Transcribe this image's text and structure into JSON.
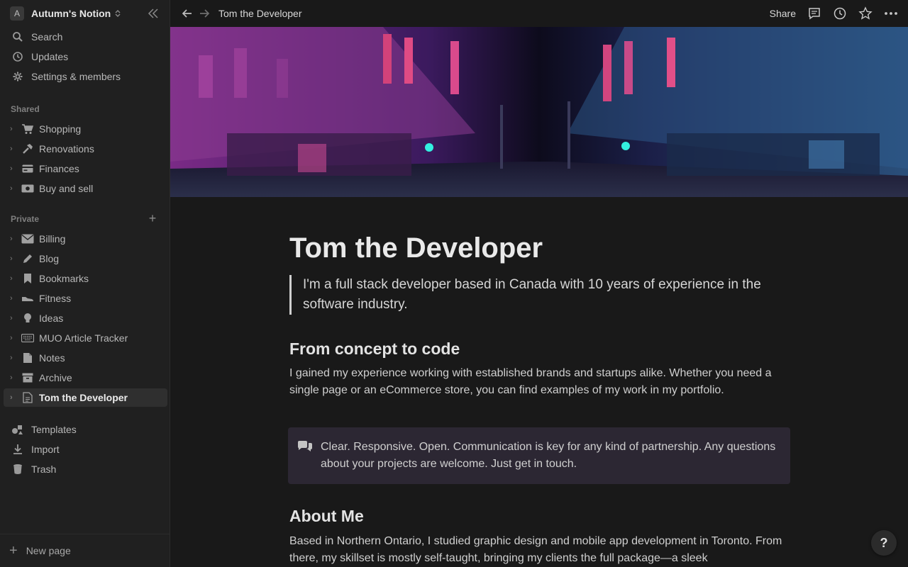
{
  "workspace": {
    "avatar": "A",
    "name": "Autumn's Notion"
  },
  "sidebar": {
    "top": [
      {
        "label": "Search",
        "icon": "search-icon"
      },
      {
        "label": "Updates",
        "icon": "clock-icon"
      },
      {
        "label": "Settings & members",
        "icon": "gear-icon"
      }
    ],
    "shared_label": "Shared",
    "shared": [
      {
        "label": "Shopping",
        "icon": "cart-icon"
      },
      {
        "label": "Renovations",
        "icon": "hammer-icon"
      },
      {
        "label": "Finances",
        "icon": "card-icon"
      },
      {
        "label": "Buy and sell",
        "icon": "money-icon"
      }
    ],
    "private_label": "Private",
    "private": [
      {
        "label": "Billing",
        "icon": "envelope-icon"
      },
      {
        "label": "Blog",
        "icon": "pencil-icon"
      },
      {
        "label": "Bookmarks",
        "icon": "bookmark-icon"
      },
      {
        "label": "Fitness",
        "icon": "shoe-icon"
      },
      {
        "label": "Ideas",
        "icon": "bulb-icon"
      },
      {
        "label": "MUO Article Tracker",
        "icon": "keyboard-icon"
      },
      {
        "label": "Notes",
        "icon": "document-icon"
      },
      {
        "label": "Archive",
        "icon": "archive-icon"
      },
      {
        "label": "Tom the Developer",
        "icon": "page-icon",
        "active": true
      }
    ],
    "bottom": [
      {
        "label": "Templates",
        "icon": "shapes-icon"
      },
      {
        "label": "Import",
        "icon": "download-icon"
      },
      {
        "label": "Trash",
        "icon": "trash-icon"
      }
    ],
    "new_page": "New page"
  },
  "topbar": {
    "breadcrumb": "Tom the Developer",
    "share": "Share"
  },
  "page": {
    "title": "Tom the Developer",
    "quote": "I'm a full stack developer based in Canada with 10 years of experience in the software industry.",
    "h1": "From concept to code",
    "p1": "I gained my experience working with established brands and startups alike. Whether you need a single page or an eCommerce store, you can find examples of my work in my portfolio.",
    "callout": "Clear. Responsive. Open. Communication is key for any kind of partnership. Any questions about your projects are welcome. Just get in touch.",
    "h2": "About Me",
    "p2": "Based in Northern Ontario, I studied graphic design and mobile app development in Toronto. From there, my skillset is mostly self-taught, bringing my clients the full package—a sleek"
  },
  "help": "?"
}
